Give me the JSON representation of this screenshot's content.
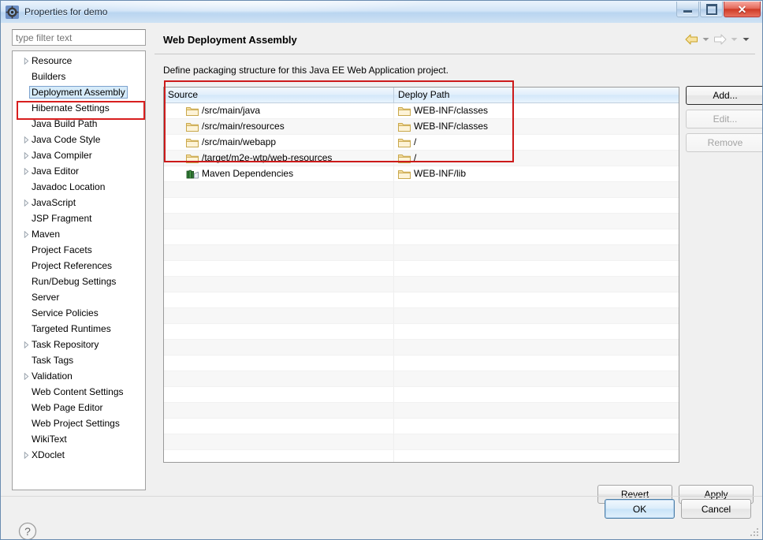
{
  "window": {
    "title": "Properties for demo",
    "app_icon": "eclipse-properties-icon",
    "controls": {
      "minimize": "minimize-icon",
      "restore": "restore-icon",
      "close": "close-icon"
    }
  },
  "sidebar": {
    "filter": {
      "value": "",
      "placeholder": "type filter text"
    },
    "items": [
      {
        "label": "Resource",
        "expandable": true,
        "selected": false
      },
      {
        "label": "Builders",
        "expandable": false,
        "selected": false
      },
      {
        "label": "Deployment Assembly",
        "expandable": false,
        "selected": true
      },
      {
        "label": "Hibernate Settings",
        "expandable": false,
        "selected": false
      },
      {
        "label": "Java Build Path",
        "expandable": false,
        "selected": false
      },
      {
        "label": "Java Code Style",
        "expandable": true,
        "selected": false
      },
      {
        "label": "Java Compiler",
        "expandable": true,
        "selected": false
      },
      {
        "label": "Java Editor",
        "expandable": true,
        "selected": false
      },
      {
        "label": "Javadoc Location",
        "expandable": false,
        "selected": false
      },
      {
        "label": "JavaScript",
        "expandable": true,
        "selected": false
      },
      {
        "label": "JSP Fragment",
        "expandable": false,
        "selected": false
      },
      {
        "label": "Maven",
        "expandable": true,
        "selected": false
      },
      {
        "label": "Project Facets",
        "expandable": false,
        "selected": false
      },
      {
        "label": "Project References",
        "expandable": false,
        "selected": false
      },
      {
        "label": "Run/Debug Settings",
        "expandable": false,
        "selected": false
      },
      {
        "label": "Server",
        "expandable": false,
        "selected": false
      },
      {
        "label": "Service Policies",
        "expandable": false,
        "selected": false
      },
      {
        "label": "Targeted Runtimes",
        "expandable": false,
        "selected": false
      },
      {
        "label": "Task Repository",
        "expandable": true,
        "selected": false
      },
      {
        "label": "Task Tags",
        "expandable": false,
        "selected": false
      },
      {
        "label": "Validation",
        "expandable": true,
        "selected": false
      },
      {
        "label": "Web Content Settings",
        "expandable": false,
        "selected": false
      },
      {
        "label": "Web Page Editor",
        "expandable": false,
        "selected": false
      },
      {
        "label": "Web Project Settings",
        "expandable": false,
        "selected": false
      },
      {
        "label": "WikiText",
        "expandable": false,
        "selected": false
      },
      {
        "label": "XDoclet",
        "expandable": true,
        "selected": false
      }
    ]
  },
  "page": {
    "title": "Web Deployment Assembly",
    "description": "Define packaging structure for this Java EE Web Application project.",
    "nav": {
      "back_icon": "back-arrow-icon",
      "back_dropdown_icon": "chevron-down-icon",
      "forward_icon": "forward-arrow-icon",
      "forward_dropdown_icon": "chevron-down-icon",
      "menu_icon": "chevron-down-icon"
    }
  },
  "table": {
    "columns": [
      "Source",
      "Deploy Path"
    ],
    "rows": [
      {
        "source_icon": "folder-icon",
        "source": "/src/main/java",
        "deploy_icon": "folder-icon",
        "deploy": "WEB-INF/classes"
      },
      {
        "source_icon": "folder-icon",
        "source": "/src/main/resources",
        "deploy_icon": "folder-icon",
        "deploy": "WEB-INF/classes"
      },
      {
        "source_icon": "folder-icon",
        "source": "/src/main/webapp",
        "deploy_icon": "folder-icon",
        "deploy": "/"
      },
      {
        "source_icon": "folder-icon",
        "source": "/target/m2e-wtp/web-resources",
        "deploy_icon": "folder-icon",
        "deploy": "/"
      },
      {
        "source_icon": "library-icon",
        "source": "Maven Dependencies",
        "deploy_icon": "folder-icon",
        "deploy": "WEB-INF/lib"
      }
    ],
    "empty_row_count": 19
  },
  "side_buttons": [
    {
      "label": "Add...",
      "enabled": true,
      "focused": true
    },
    {
      "label": "Edit...",
      "enabled": false,
      "focused": false
    },
    {
      "label": "Remove",
      "enabled": false,
      "focused": false
    }
  ],
  "apply_buttons": [
    {
      "label": "Revert"
    },
    {
      "label": "Apply"
    }
  ],
  "footer": {
    "help_icon": "help-question-icon",
    "buttons": [
      {
        "label": "OK",
        "default": true
      },
      {
        "label": "Cancel",
        "default": false
      }
    ]
  },
  "annotations": [
    {
      "name": "sidebar-highlight",
      "color": "#d81e1e"
    },
    {
      "name": "table-rows-highlight",
      "color": "#cc1a1a"
    }
  ]
}
